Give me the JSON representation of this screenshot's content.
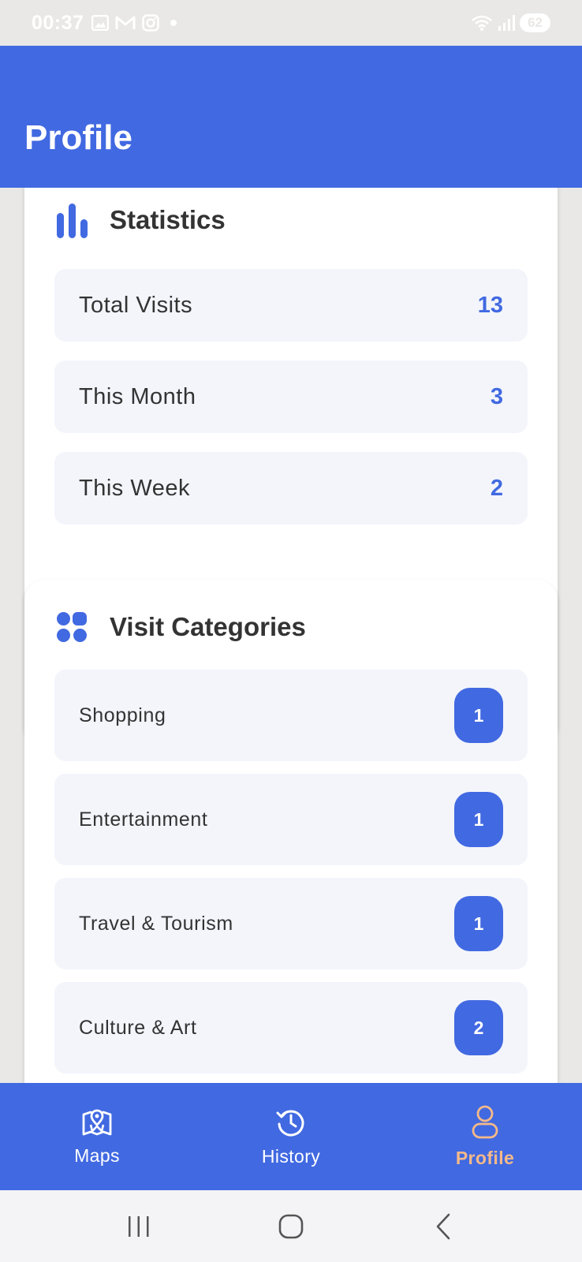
{
  "status_bar": {
    "time": "00:37",
    "battery": "62",
    "icons": [
      "gallery-icon",
      "gmail-icon",
      "instagram-icon",
      "wifi-icon",
      "signal-icon"
    ]
  },
  "header": {
    "title": "Profile"
  },
  "statistics": {
    "title": "Statistics",
    "icon": "bar-chart-icon",
    "rows": [
      {
        "label": "Total Visits",
        "value": "13"
      },
      {
        "label": "This Month",
        "value": "3"
      },
      {
        "label": "This Week",
        "value": "2"
      }
    ]
  },
  "categories": {
    "title": "Visit Categories",
    "icon": "category-grid-icon",
    "rows": [
      {
        "label": "Shopping",
        "count": "1"
      },
      {
        "label": "Entertainment",
        "count": "1"
      },
      {
        "label": "Travel & Tourism",
        "count": "1"
      },
      {
        "label": "Culture & Art",
        "count": "2"
      }
    ]
  },
  "bottom_nav": {
    "items": [
      {
        "label": "Maps",
        "icon": "map-icon",
        "active": false
      },
      {
        "label": "History",
        "icon": "history-icon",
        "active": false
      },
      {
        "label": "Profile",
        "icon": "profile-icon",
        "active": true
      }
    ]
  },
  "colors": {
    "primary": "#4169e1",
    "active_nav": "#f5b98a",
    "row_bg": "#f3f5fb",
    "text": "#333333"
  }
}
